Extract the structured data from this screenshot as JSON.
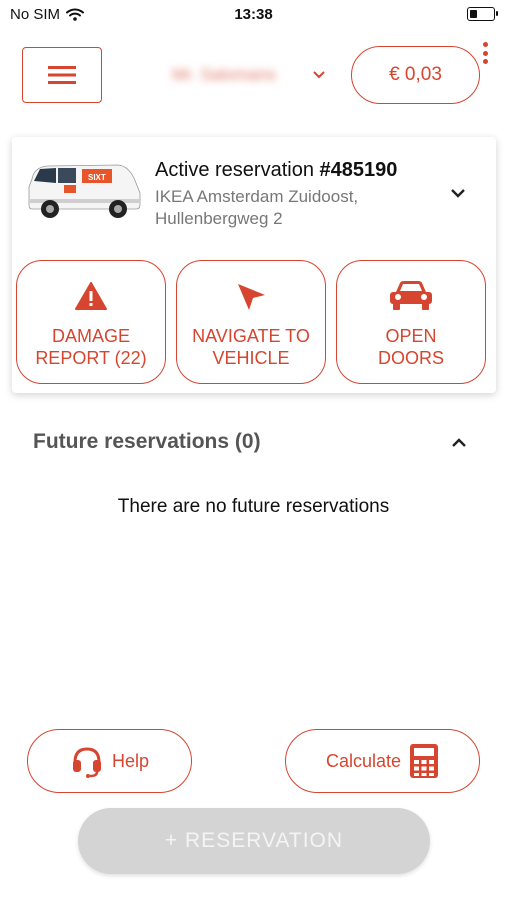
{
  "status_bar": {
    "carrier": "No SIM",
    "time": "13:38",
    "battery_level": 0.3
  },
  "header": {
    "account_name": "Mr. Salomans",
    "balance": "€ 0,03"
  },
  "active_reservation": {
    "label": "Active reservation ",
    "number": "#485190",
    "address": "IKEA Amsterdam Zuidoost, Hullenbergweg 2",
    "van_brand": "SIXT"
  },
  "actions": [
    {
      "label": "DAMAGE REPORT (22)",
      "icon": "warning-icon"
    },
    {
      "label": "NAVIGATE TO VEHICLE",
      "icon": "navigation-arrow-icon"
    },
    {
      "label": "OPEN DOORS",
      "icon": "car-icon"
    }
  ],
  "future": {
    "title": "Future reservations (0)",
    "empty_text": "There are no future reservations"
  },
  "footer": {
    "help_label": "Help",
    "calculate_label": "Calculate",
    "reservation_label": "+ RESERVATION"
  },
  "colors": {
    "accent": "#d6452f",
    "disabled": "#d4d4d4",
    "muted_text": "#777777"
  }
}
